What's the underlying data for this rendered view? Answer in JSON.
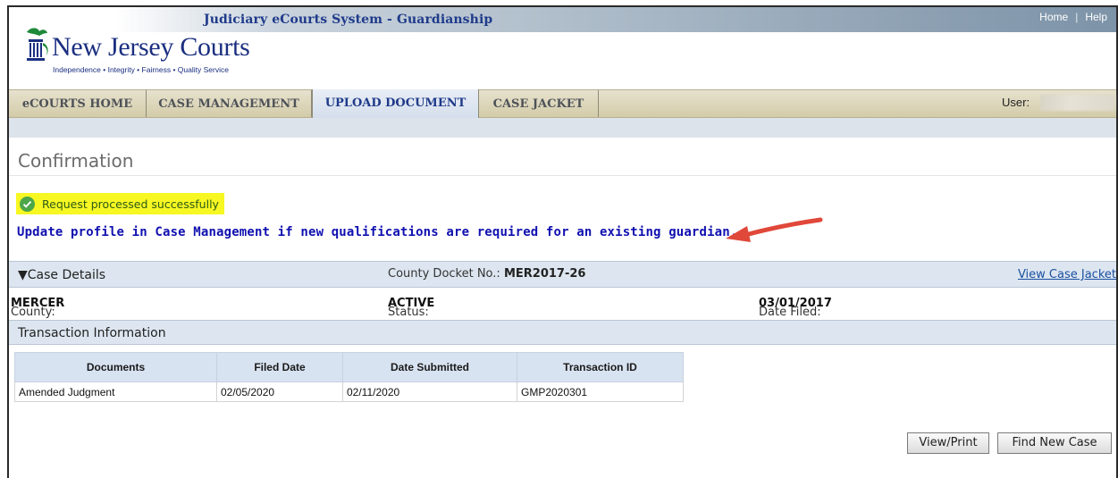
{
  "header": {
    "system_title": "Judiciary eCourts System - Guardianship",
    "links": {
      "home": "Home",
      "separator": "|",
      "help": "Help"
    },
    "logo": {
      "name": "New Jersey Courts",
      "tagline": "Independence • Integrity • Fairness • Quality Service"
    }
  },
  "nav": {
    "tabs": [
      {
        "label": "eCOURTS HOME"
      },
      {
        "label": "CASE MANAGEMENT"
      },
      {
        "label": "UPLOAD DOCUMENT",
        "active": true
      },
      {
        "label": "CASE JACKET"
      }
    ],
    "user_label": "User:"
  },
  "page": {
    "title": "Confirmation",
    "success_message": "Request processed successfully",
    "notice": "Update profile in Case Management if new qualifications are required for an existing guardian."
  },
  "case_details": {
    "heading": "▼Case Details",
    "docket_label": "County Docket No.:",
    "docket_value": "MER2017-26",
    "view_case_jacket": "View Case Jacket",
    "county_label": "County:",
    "county_value": "MERCER",
    "status_label": "Status:",
    "status_value": "ACTIVE",
    "date_filed_label": "Date Filed:",
    "date_filed_value": "03/01/2017"
  },
  "transactions": {
    "heading": "Transaction Information",
    "columns": [
      "Documents",
      "Filed Date",
      "Date Submitted",
      "Transaction ID"
    ],
    "rows": [
      [
        "Amended Judgment",
        "02/05/2020",
        "02/11/2020",
        "GMP2020301"
      ]
    ]
  },
  "buttons": {
    "view_print": "View/Print",
    "find_new_case": "Find New Case"
  },
  "colors": {
    "brand_blue": "#1b2f80",
    "notice_blue": "#1010b0",
    "success_highlight": "#f7f723",
    "arrow_red": "#e0483a"
  },
  "icons": [
    "nj-courts-emblem-icon",
    "check-circle-icon",
    "red-arrow-icon"
  ]
}
